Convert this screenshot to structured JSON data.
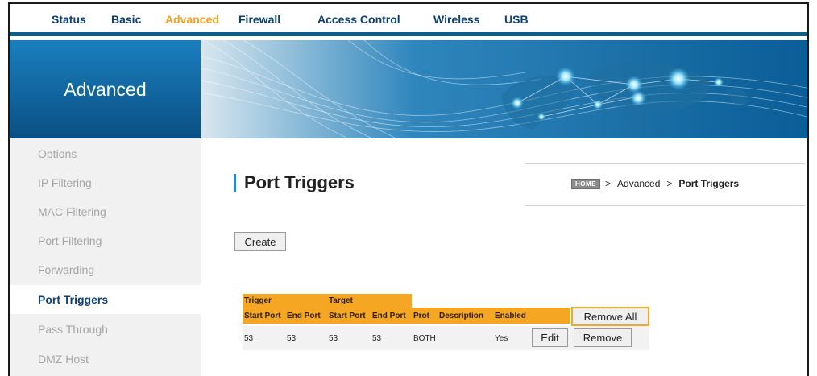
{
  "nav": {
    "tabs": [
      {
        "label": "Status"
      },
      {
        "label": "Basic"
      },
      {
        "label": "Advanced"
      },
      {
        "label": "Firewall"
      },
      {
        "label": "Access Control"
      },
      {
        "label": "Wireless"
      },
      {
        "label": "USB"
      }
    ],
    "active": "Advanced"
  },
  "banner": {
    "title": "Advanced"
  },
  "sidebar": {
    "items": [
      {
        "label": "Options"
      },
      {
        "label": "IP Filtering"
      },
      {
        "label": "MAC Filtering"
      },
      {
        "label": "Port Filtering"
      },
      {
        "label": "Forwarding"
      },
      {
        "label": "Port Triggers"
      },
      {
        "label": "Pass Through"
      },
      {
        "label": "DMZ Host"
      }
    ],
    "active": "Port Triggers"
  },
  "page": {
    "title": "Port Triggers"
  },
  "breadcrumb": {
    "home_badge": "HOME",
    "separator": ">",
    "items": [
      "Advanced",
      "Port Triggers"
    ]
  },
  "buttons": {
    "create": "Create",
    "remove_all": "Remove All",
    "edit": "Edit",
    "remove": "Remove"
  },
  "table": {
    "groups": [
      {
        "label": "Trigger"
      },
      {
        "label": "Target"
      }
    ],
    "columns": [
      "Start Port",
      "End Port",
      "Start Port",
      "End Port",
      "Prot",
      "Description",
      "Enabled"
    ],
    "rows": [
      {
        "cells": [
          "53",
          "53",
          "53",
          "53",
          "BOTH",
          "",
          "Yes"
        ]
      }
    ]
  },
  "colors": {
    "accent": "#f5a623",
    "nav_active": "#f5a01c",
    "nav_text": "#0c3f73",
    "banner": "#0c6aa6"
  }
}
